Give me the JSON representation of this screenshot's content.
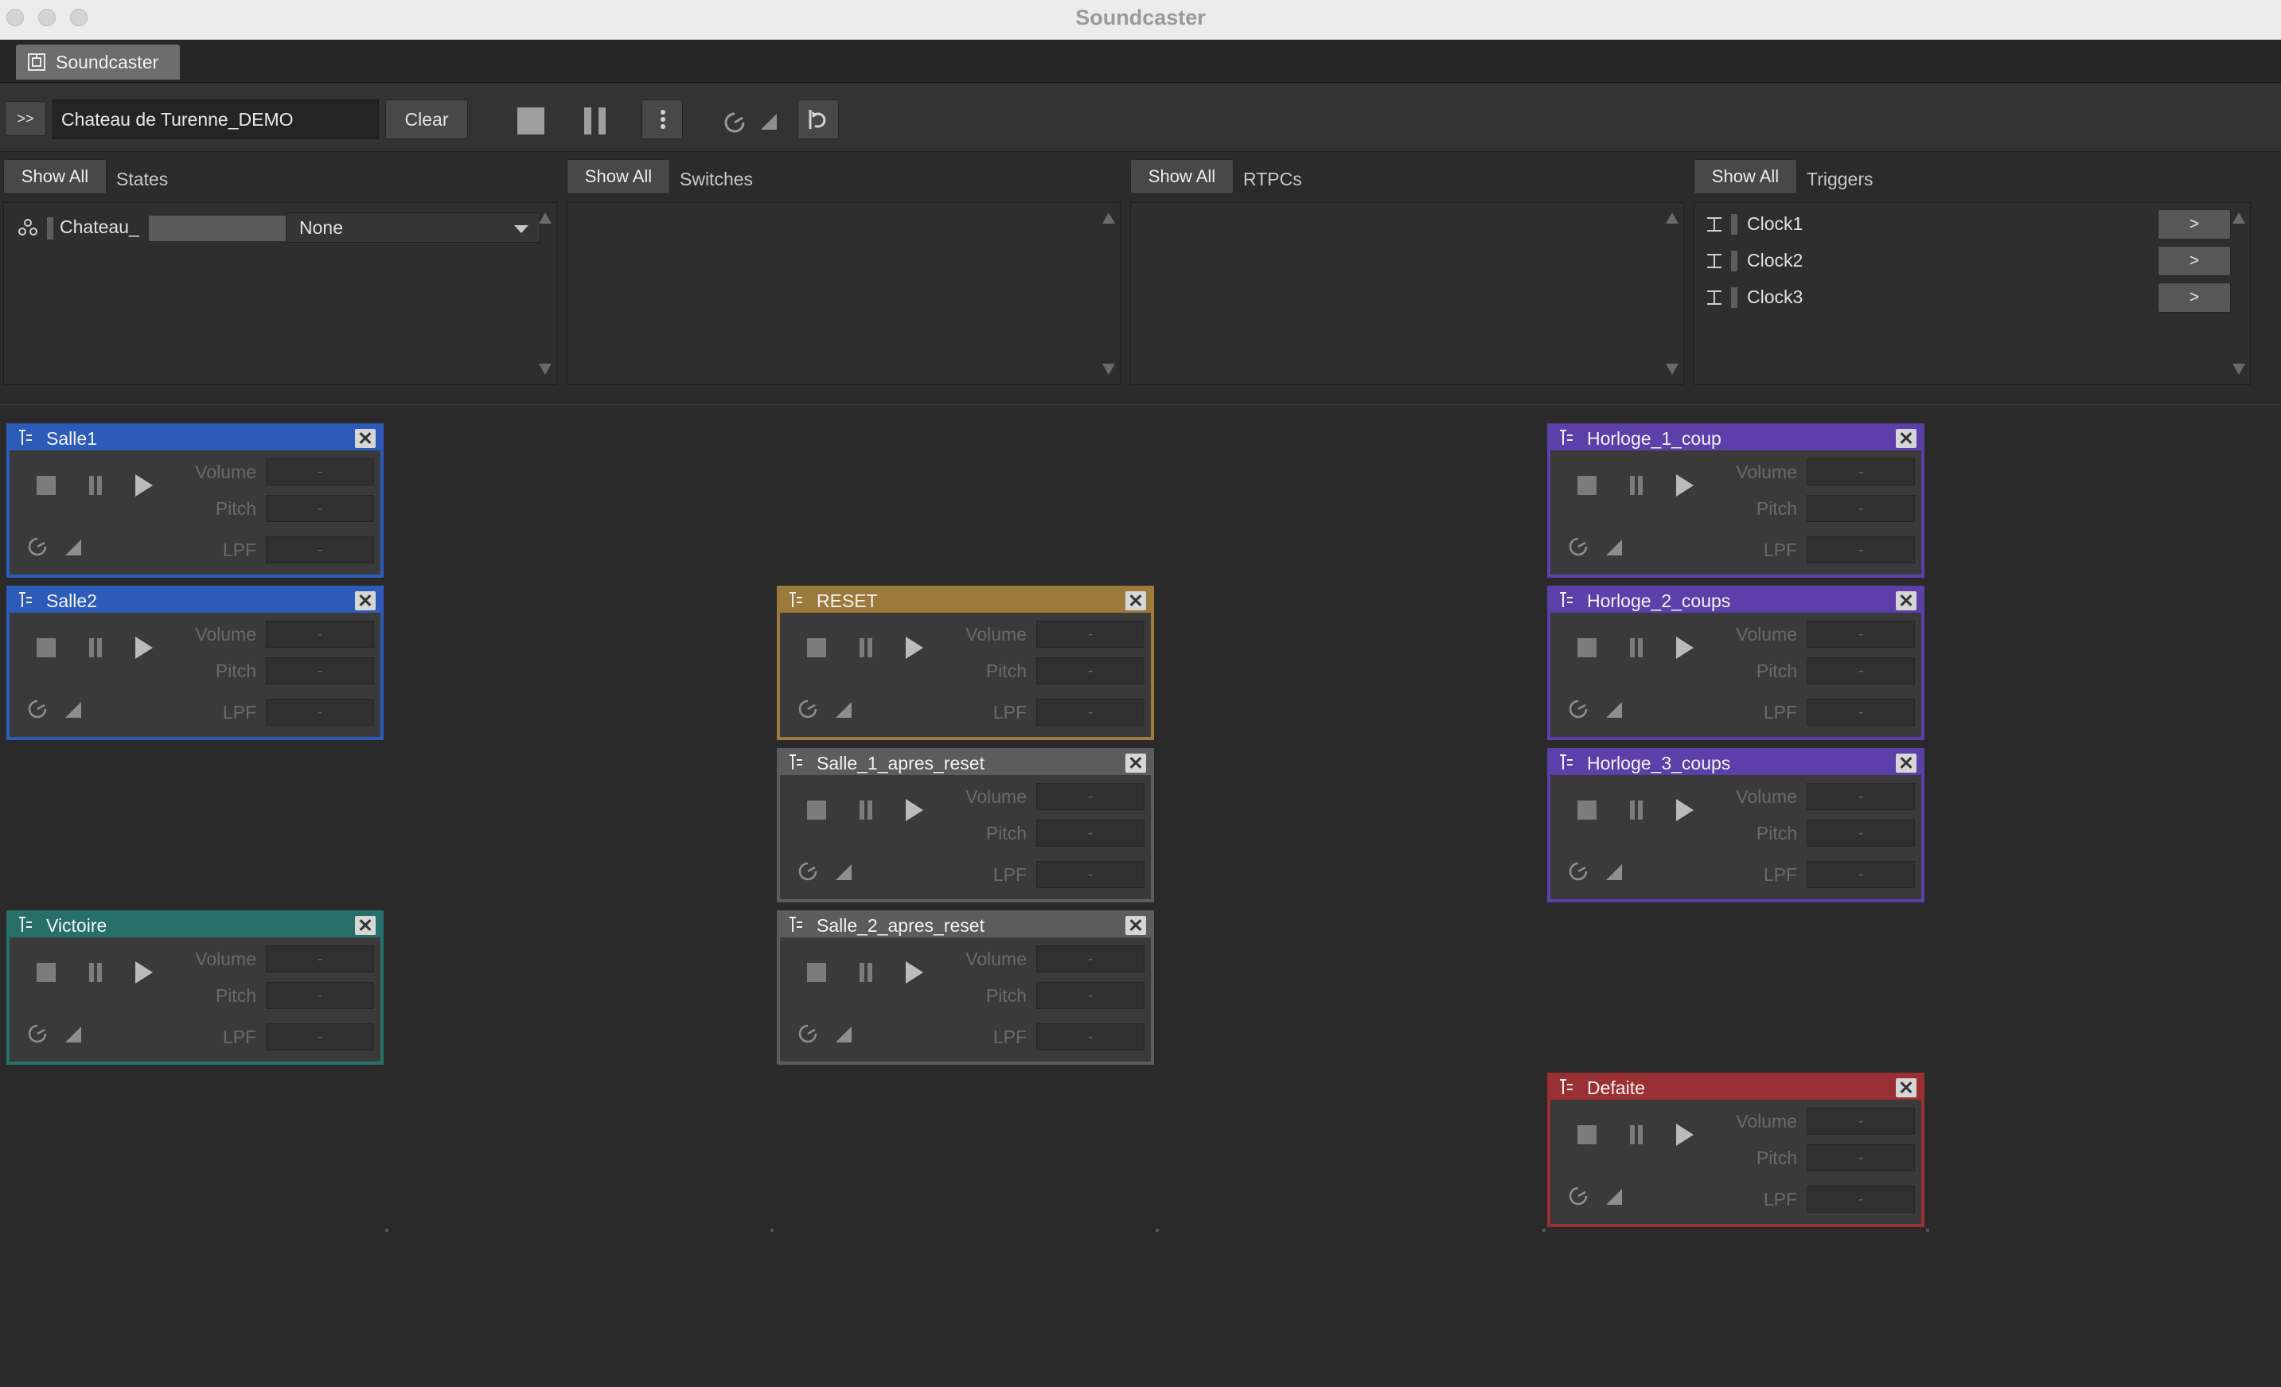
{
  "window": {
    "title": "Soundcaster"
  },
  "tab": {
    "label": "Soundcaster"
  },
  "toolbar": {
    "expand_label": ">>",
    "session_name": "Chateau de Turenne_DEMO",
    "clear_label": "Clear"
  },
  "sections": {
    "states": {
      "show_all": "Show All",
      "title": "States",
      "row": {
        "name": "Chateau_",
        "value": "None"
      }
    },
    "switches": {
      "show_all": "Show All",
      "title": "Switches"
    },
    "rtpcs": {
      "show_all": "Show All",
      "title": "RTPCs"
    },
    "triggers": {
      "show_all": "Show All",
      "title": "Triggers",
      "items": [
        {
          "name": "Clock1",
          "button": ">"
        },
        {
          "name": "Clock2",
          "button": ">"
        },
        {
          "name": "Clock3",
          "button": ">"
        }
      ]
    }
  },
  "param_labels": {
    "volume": "Volume",
    "pitch": "Pitch",
    "lpf": "LPF",
    "empty_value": "-"
  },
  "cards": [
    {
      "title": "Salle1",
      "color": "#2d5bb8"
    },
    {
      "title": "Salle2",
      "color": "#2d5bb8"
    },
    {
      "title": "Victoire",
      "color": "#27706a"
    },
    {
      "title": "RESET",
      "color": "#9c7a3c"
    },
    {
      "title": "Salle_1_apres_reset",
      "color": "#5c5c5c"
    },
    {
      "title": "Salle_2_apres_reset",
      "color": "#5c5c5c"
    },
    {
      "title": "Horloge_1_coup",
      "color": "#5c3fa8"
    },
    {
      "title": "Horloge_2_coups",
      "color": "#5c3fa8"
    },
    {
      "title": "Horloge_3_coups",
      "color": "#5c3fa8"
    },
    {
      "title": "Defaite",
      "color": "#9a2f34"
    }
  ],
  "icons": {
    "tab": "soundcaster-icon",
    "pin": "pin-icon",
    "help": "help-icon",
    "close": "close-icon",
    "state_group": "state-group-icon",
    "trigger": "trigger-icon",
    "card": "event-icon"
  },
  "colors": {
    "accent_pin": "#e0882a"
  }
}
